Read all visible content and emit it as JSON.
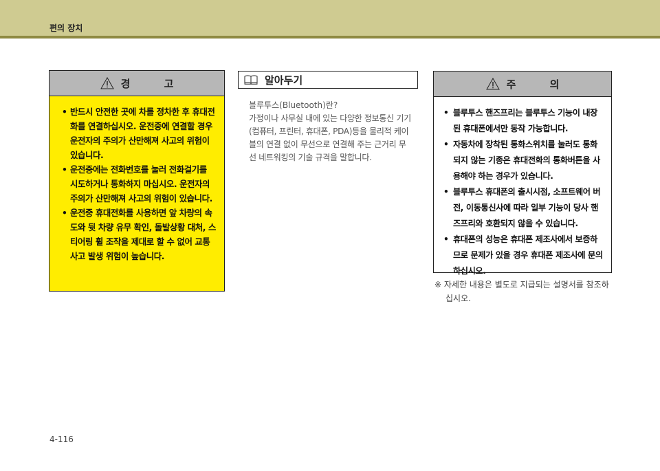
{
  "header": {
    "title": "편의 장치",
    "band_color": "#cfcb91",
    "rule_color": "#8f8a42"
  },
  "warning": {
    "title": "경 고",
    "icon": "warning-triangle-icon",
    "bg_color": "#ffed00",
    "items": [
      "반드시 안전한 곳에 차를 정차한 후 휴대전화를 연결하십시오. 운전중에 연결할 경우 운전자의 주의가 산만해져 사고의 위험이 있습니다.",
      "운전중에는 전화번호를 눌러 전화걸기를 시도하거나 통화하지 마십시오. 운전자의 주의가 산만해져 사고의 위험이 있습니다.",
      "운전중 휴대전화를 사용하면 앞 차량의 속도와 뒷 차량 유무 확인, 돌발상황 대처, 스티어링 휠 조작을 제대로 할 수 없어 교통사고 발생 위험이 높습니다."
    ]
  },
  "info": {
    "title": "알아두기",
    "icon": "book-icon",
    "question": "블루투스(Bluetooth)란?",
    "body": "가정이나 사무실 내에 있는 다양한 정보통신 기기(컴퓨터, 프린터, 휴대폰, PDA)등을 물리적 케이블의 연결 없이 무선으로 연결해 주는 근거리 무선 네트워킹의 기술 규격을 말합니다."
  },
  "caution": {
    "title": "주 의",
    "icon": "caution-triangle-icon",
    "items": [
      "블루투스 핸즈프리는 블루투스 기능이 내장된 휴대폰에서만 동작 가능합니다.",
      "자동차에 장착된 통화스위치를 눌러도 통화 되지 않는 기종은 휴대전화의 통화버튼을 사용해야 하는 경우가 있습니다.",
      "블루투스 휴대폰의 출시시점, 소프트웨어 버전, 이동통신사에 따라 일부 기능이 당사 핸즈프리와 호환되지 않을 수 있습니다.",
      "휴대폰의 성능은 휴대폰 제조사에서 보증하므로 문제가 있을 경우 휴대폰 제조사에 문의 하십시오."
    ]
  },
  "note": "※ 자세한 내용은 별도로 지급되는 설명서를 참조하십시오.",
  "page_number": "4-116"
}
